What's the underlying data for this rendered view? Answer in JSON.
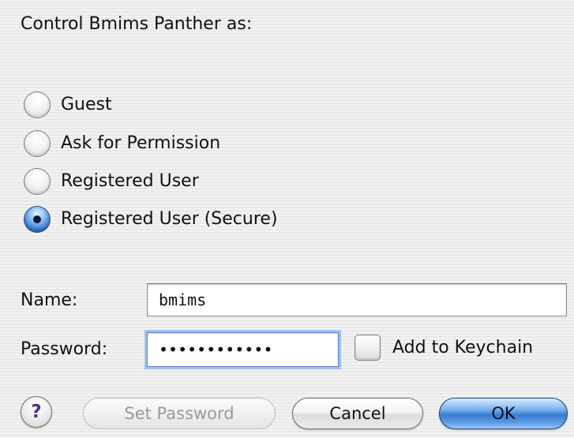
{
  "dialog": {
    "heading": "Control Bmims Panther as:",
    "radio_options": [
      {
        "label": "Guest",
        "selected": false
      },
      {
        "label": "Ask for Permission",
        "selected": false
      },
      {
        "label": "Registered User",
        "selected": false
      },
      {
        "label": "Registered User (Secure)",
        "selected": true
      }
    ],
    "name_label": "Name:",
    "name_value": "bmims",
    "password_label": "Password:",
    "password_value": "••••••••••••",
    "keychain_label": "Add to Keychain",
    "keychain_checked": false,
    "help_glyph": "?",
    "set_password_label": "Set Password",
    "cancel_label": "Cancel",
    "ok_label": "OK"
  },
  "colors": {
    "default_button": "#3b7cd0",
    "help_glyph": "#5b2a86",
    "focus_ring": "#9fc1ea"
  },
  "icons": {
    "help": "help-icon"
  }
}
